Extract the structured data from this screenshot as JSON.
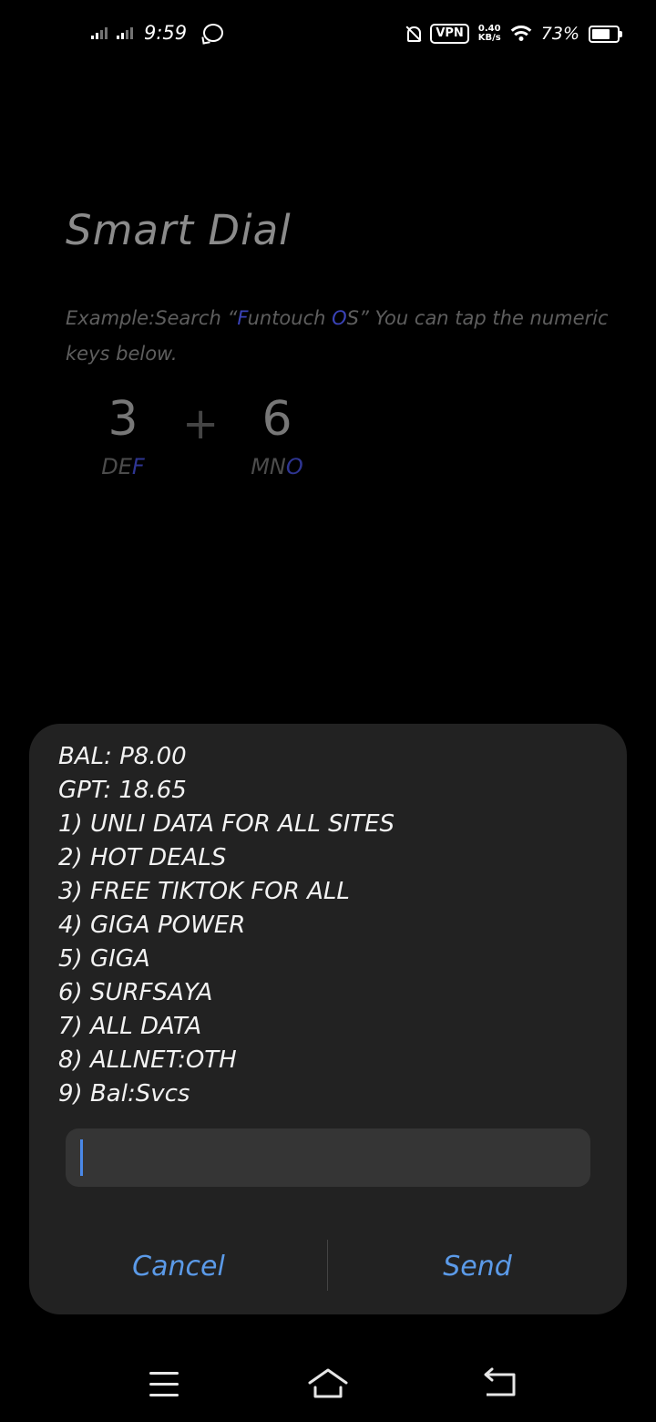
{
  "status_bar": {
    "time": "9:59",
    "vpn_label": "VPN",
    "speed_value": "0.40",
    "speed_unit": "KB/s",
    "battery_percent": "73%"
  },
  "background": {
    "title": "Smart Dial",
    "example_prefix": "Example:Search “",
    "example_f": "F",
    "example_mid": "untouch ",
    "example_o": "O",
    "example_suffix": "S” You can tap the numeric keys below.",
    "key1_digit": "3",
    "key1_letters_a": "DE",
    "key1_letters_b": "F",
    "plus": "+",
    "key2_digit": "6",
    "key2_letters_a": "MN",
    "key2_letters_b": "O"
  },
  "dialog": {
    "lines": [
      "BAL: P8.00",
      "GPT: 18.65",
      "1) UNLI DATA FOR ALL SITES",
      "2) HOT DEALS",
      "3) FREE TIKTOK FOR ALL",
      "4) GIGA POWER",
      "5) GIGA",
      "6) SURFSAYA",
      "7) ALL DATA",
      "8) ALLNET:OTH",
      "9) Bal:Svcs"
    ],
    "input_value": "",
    "cancel_label": "Cancel",
    "send_label": "Send"
  },
  "nav": {
    "icons": [
      "menu-icon",
      "home-icon",
      "back-icon"
    ]
  },
  "colors": {
    "accent": "#5b9ae8",
    "dialog_bg": "#222222",
    "input_bg": "#353535"
  }
}
